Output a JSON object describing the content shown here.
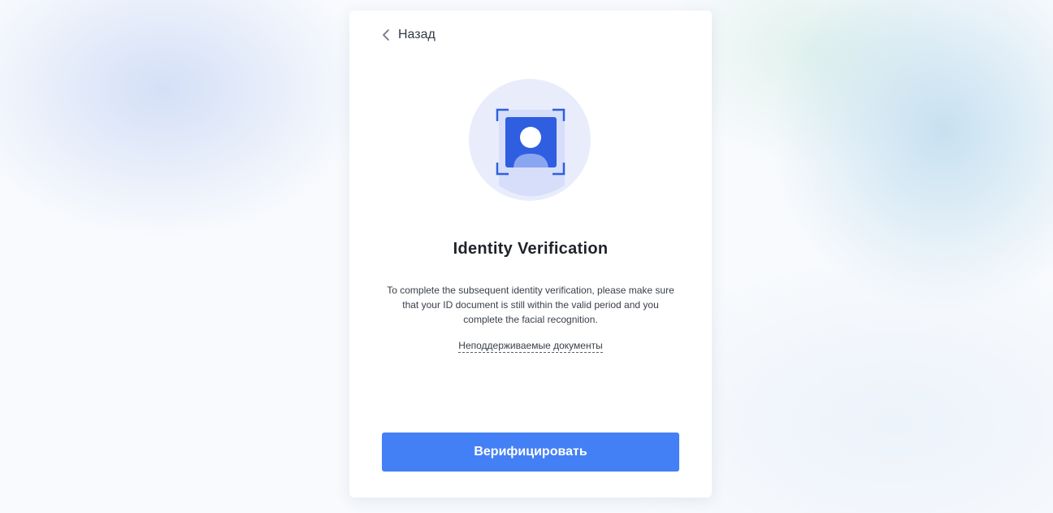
{
  "header": {
    "back_label": "Назад"
  },
  "hero": {
    "icon": "id-face-scan-icon"
  },
  "content": {
    "title": "Identity Verification",
    "description": "To complete the subsequent identity verification, please make sure that your ID document is still within the valid period and you complete the facial recognition.",
    "unsupported_docs_link": "Неподдерживаемые документы"
  },
  "actions": {
    "verify_label": "Верифицировать"
  },
  "colors": {
    "accent": "#4480f5",
    "icon_blue": "#2f5fe0",
    "circle": "#e9edfb"
  }
}
